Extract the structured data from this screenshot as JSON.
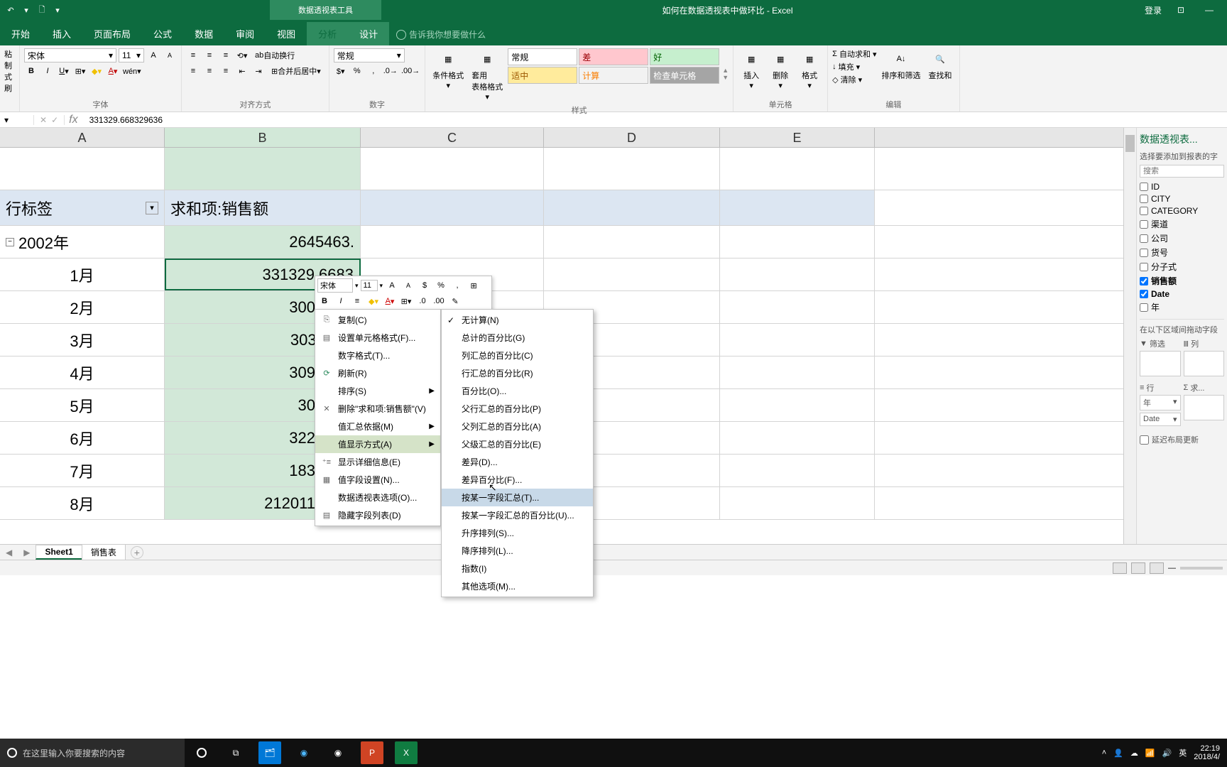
{
  "titlebar": {
    "tool": "数据透视表工具",
    "title": "如何在数据透视表中做环比 - Excel",
    "login": "登录"
  },
  "tabs": {
    "start": "开始",
    "insert": "插入",
    "layout": "页面布局",
    "formula": "公式",
    "data": "数据",
    "review": "审阅",
    "view": "视图",
    "analyze": "分析",
    "design": "设计",
    "tellme": "告诉我你想要做什么"
  },
  "ribbon": {
    "clipboard": {
      "paste": "粘",
      "copy": "制",
      "brush": "式刷",
      "label": ""
    },
    "font": {
      "name": "宋体",
      "size": "11",
      "label": "字体"
    },
    "align": {
      "wrap": "自动换行",
      "merge": "合并后居中",
      "label": "对齐方式"
    },
    "number": {
      "fmt": "常规",
      "label": "数字"
    },
    "styles": {
      "cond": "条件格式",
      "table": "套用\n表格格式",
      "normal": "常规",
      "bad": "差",
      "good": "好",
      "neutral": "适中",
      "calc": "计算",
      "check": "检查单元格",
      "label": "样式"
    },
    "cells": {
      "insert": "插入",
      "delete": "删除",
      "format": "格式",
      "label": "单元格"
    },
    "editing": {
      "sum": "自动求和",
      "fill": "填充",
      "clear": "清除",
      "sort": "排序和筛选",
      "find": "查找和",
      "label": "编辑"
    }
  },
  "formula": {
    "value": "331329.668329636"
  },
  "cols": {
    "A": "A",
    "B": "B",
    "C": "C",
    "D": "D",
    "E": "E"
  },
  "grid": {
    "h1": "行标签",
    "h2": "求和项:销售额",
    "y": "2002年",
    "yval": "2645463.",
    "m": [
      "1月",
      "2月",
      "3月",
      "4月",
      "5月",
      "6月",
      "7月",
      "8月"
    ],
    "v": [
      "331329.6683",
      "300144.4",
      "303110.6",
      "309572.6",
      "307469.",
      "322441.3",
      "183881.7",
      "212011  2427"
    ]
  },
  "minitb": {
    "font": "宋体",
    "size": "11"
  },
  "ctx": {
    "copy": "复制(C)",
    "format": "设置单元格格式(F)...",
    "numfmt": "数字格式(T)...",
    "refresh": "刷新(R)",
    "sort": "排序(S)",
    "remove": "删除\"求和项:销售额\"(V)",
    "summarize": "值汇总依据(M)",
    "showas": "值显示方式(A)",
    "details": "显示详细信息(E)",
    "fieldset": "值字段设置(N)...",
    "options": "数据透视表选项(O)...",
    "hidefield": "隐藏字段列表(D)"
  },
  "sub": {
    "nocalc": "无计算(N)",
    "grandpct": "总计的百分比(G)",
    "colpct": "列汇总的百分比(C)",
    "rowpct": "行汇总的百分比(R)",
    "pct": "百分比(O)...",
    "parentrow": "父行汇总的百分比(P)",
    "parentcol": "父列汇总的百分比(A)",
    "parent": "父级汇总的百分比(E)",
    "diff": "差异(D)...",
    "pctdiff": "差异百分比(F)...",
    "runtot": "按某一字段汇总(T)...",
    "runpct": "按某一字段汇总的百分比(U)...",
    "rankasc": "升序排列(S)...",
    "rankdesc": "降序排列(L)...",
    "index": "指数(I)",
    "more": "其他选项(M)..."
  },
  "pane": {
    "title": "数据透视表...",
    "sub": "选择要添加到报表的字",
    "search": "搜索",
    "fields": [
      "ID",
      "CITY",
      "CATEGORY",
      "渠道",
      "公司",
      "货号",
      "分子式",
      "销售额",
      "Date",
      "年"
    ],
    "checked": [
      "销售额",
      "Date"
    ],
    "areas_label": "在以下区域间拖动字段",
    "filter": "筛选",
    "cols": "列",
    "rows": "行",
    "vals": "求...",
    "row1": "年",
    "row2": "Date",
    "defer": "延迟布局更新"
  },
  "tabs_bottom": {
    "s1": "Sheet1",
    "s2": "销售表"
  },
  "taskbar": {
    "search": "在这里输入你要搜索的内容",
    "ime": "英",
    "time": "22:19",
    "date": "2018/4/"
  }
}
